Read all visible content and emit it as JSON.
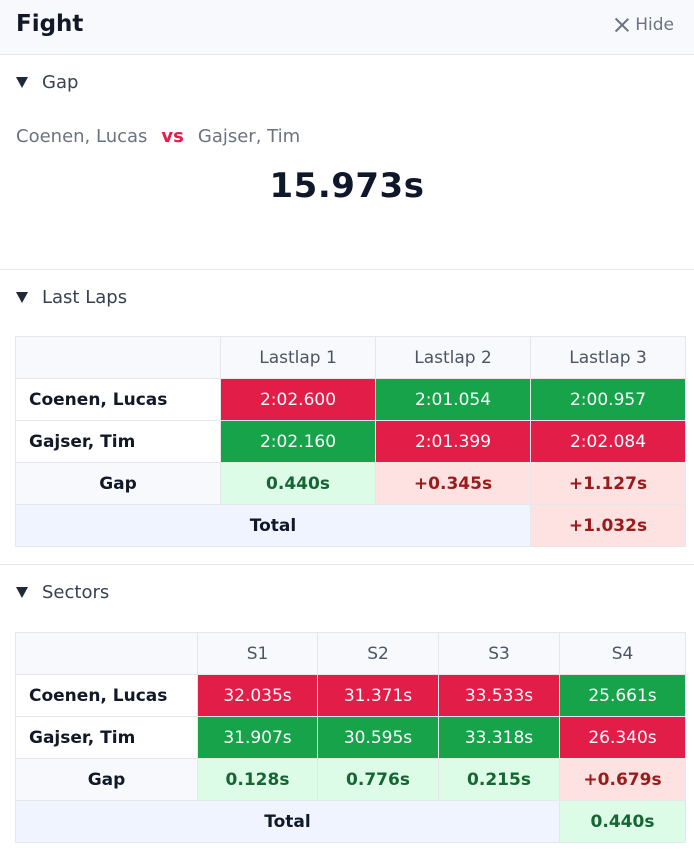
{
  "header": {
    "title": "Fight",
    "hide_label": "Hide"
  },
  "gap_section": {
    "label": "Gap",
    "driver_a": "Coenen, Lucas",
    "vs": "vs",
    "driver_b": "Gajser, Tim",
    "value": "15.973s"
  },
  "laps_section": {
    "label": "Last Laps",
    "columns": [
      "Lastlap 1",
      "Lastlap 2",
      "Lastlap 3"
    ],
    "rows": [
      {
        "name": "Coenen, Lucas",
        "cells": [
          "2:02.600",
          "2:01.054",
          "2:00.957"
        ]
      },
      {
        "name": "Gajser, Tim",
        "cells": [
          "2:02.160",
          "2:01.399",
          "2:02.084"
        ]
      }
    ],
    "gap_label": "Gap",
    "gaps": [
      "0.440s",
      "+0.345s",
      "+1.127s"
    ],
    "total_label": "Total",
    "total": "+1.032s"
  },
  "sectors_section": {
    "label": "Sectors",
    "columns": [
      "S1",
      "S2",
      "S3",
      "S4"
    ],
    "rows": [
      {
        "name": "Coenen, Lucas",
        "cells": [
          "32.035s",
          "31.371s",
          "33.533s",
          "25.661s"
        ]
      },
      {
        "name": "Gajser, Tim",
        "cells": [
          "31.907s",
          "30.595s",
          "33.318s",
          "26.340s"
        ]
      }
    ],
    "gap_label": "Gap",
    "gaps": [
      "0.128s",
      "0.776s",
      "0.215s",
      "+0.679s"
    ],
    "total_label": "Total",
    "total": "0.440s"
  },
  "colors": {
    "slower": "#e11d48",
    "faster": "#16a34a",
    "gain_bg": "#dcfce7",
    "loss_bg": "#fee2e2"
  }
}
